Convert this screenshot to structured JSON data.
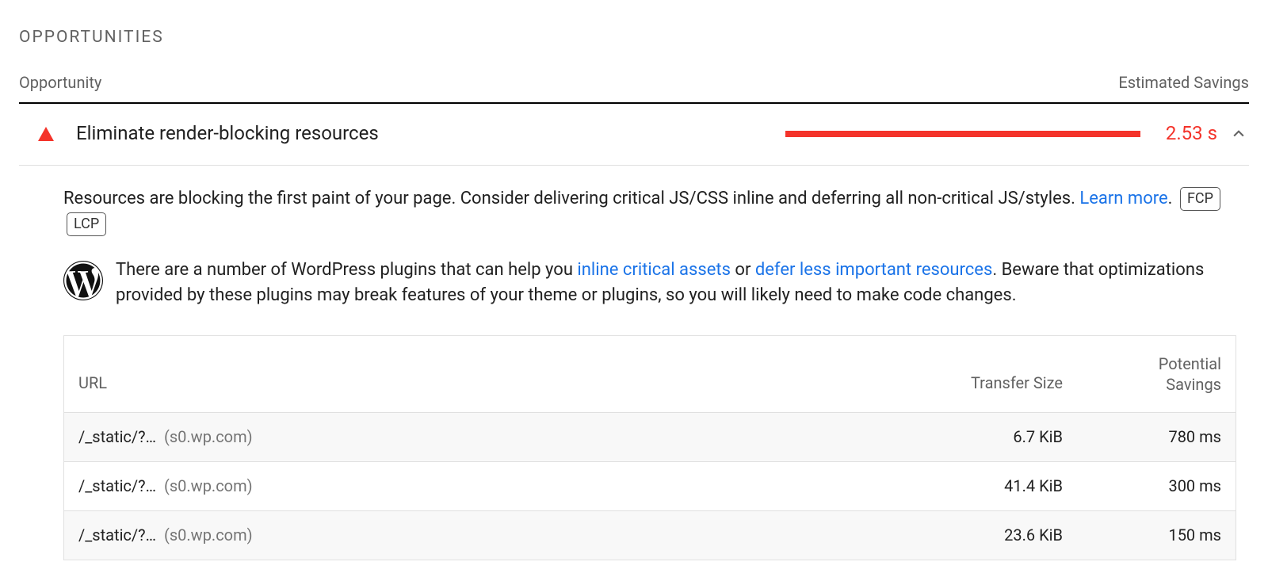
{
  "section_title": "OPPORTUNITIES",
  "header": {
    "left": "Opportunity",
    "right": "Estimated Savings"
  },
  "opportunity": {
    "title": "Eliminate render-blocking resources",
    "savings": "2.53 s"
  },
  "description": {
    "text_before": "Resources are blocking the first paint of your page. Consider deliverin​g critical JS/CSS inline and deferring all non-critical JS/styles. ",
    "learn_more": "Learn more",
    "period": ".",
    "badges": [
      "FCP",
      "LCP"
    ]
  },
  "wp_hint": {
    "t1": "There are a number of WordPress plugins that can help you ",
    "link1": "inline critical assets",
    "t2": " or ",
    "link2": "defer less important resources",
    "t3": ". Beware that optimizations provided by these plugins may break features of your theme or plugins, so you will likely need to make code changes."
  },
  "table": {
    "headers": {
      "url": "URL",
      "size": "Transfer Size",
      "savings_l1": "Potential",
      "savings_l2": "Savings"
    },
    "rows": [
      {
        "path": "/_static/?…",
        "host": "(s0.wp.com)",
        "size": "6.7 KiB",
        "savings": "780 ms"
      },
      {
        "path": "/_static/?…",
        "host": "(s0.wp.com)",
        "size": "41.4 KiB",
        "savings": "300 ms"
      },
      {
        "path": "/_static/?…",
        "host": "(s0.wp.com)",
        "size": "23.6 KiB",
        "savings": "150 ms"
      }
    ]
  }
}
